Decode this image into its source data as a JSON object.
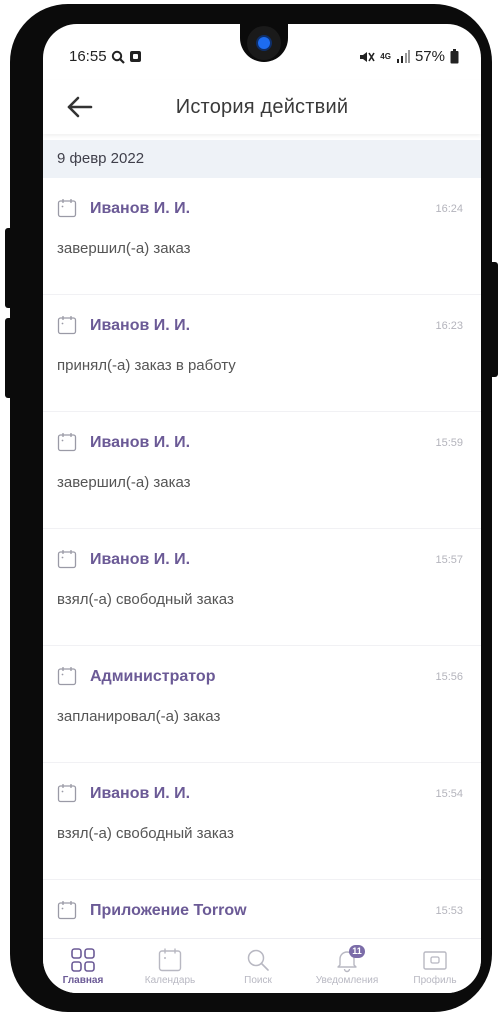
{
  "status_bar": {
    "time": "16:55",
    "signal": "4G",
    "battery": "57%",
    "icons": [
      "search-icon",
      "screenshot-icon",
      "mute-icon",
      "signal-icon",
      "battery-icon"
    ]
  },
  "header": {
    "title": "История действий",
    "back_icon": "arrow-left-icon"
  },
  "date_group": "9 февр 2022",
  "events": [
    {
      "actor": "Иванов И. И.",
      "time": "16:24",
      "action": "завершил(-а) заказ"
    },
    {
      "actor": "Иванов И. И.",
      "time": "16:23",
      "action": "принял(-а) заказ в работу"
    },
    {
      "actor": "Иванов И. И.",
      "time": "15:59",
      "action": "завершил(-а) заказ"
    },
    {
      "actor": "Иванов И. И.",
      "time": "15:57",
      "action": "взял(-а) свободный заказ"
    },
    {
      "actor": "Администратор",
      "time": "15:56",
      "action": "запланировал(-а) заказ"
    },
    {
      "actor": "Иванов И. И.",
      "time": "15:54",
      "action": "взял(-а) свободный заказ"
    },
    {
      "actor": "Приложение Torrow",
      "time": "15:53",
      "action": ""
    }
  ],
  "bottom_nav": [
    {
      "label": "Главная",
      "icon": "grid-icon",
      "active": true
    },
    {
      "label": "Календарь",
      "icon": "calendar-icon",
      "active": false
    },
    {
      "label": "Поиск",
      "icon": "search-icon",
      "active": false
    },
    {
      "label": "Уведомления",
      "icon": "bell-icon",
      "active": false,
      "badge": "11"
    },
    {
      "label": "Профиль",
      "icon": "profile-icon",
      "active": false
    }
  ],
  "colors": {
    "accent": "#6b5a96",
    "date_header_bg": "#eef2f7",
    "muted": "#b8b8c2"
  }
}
